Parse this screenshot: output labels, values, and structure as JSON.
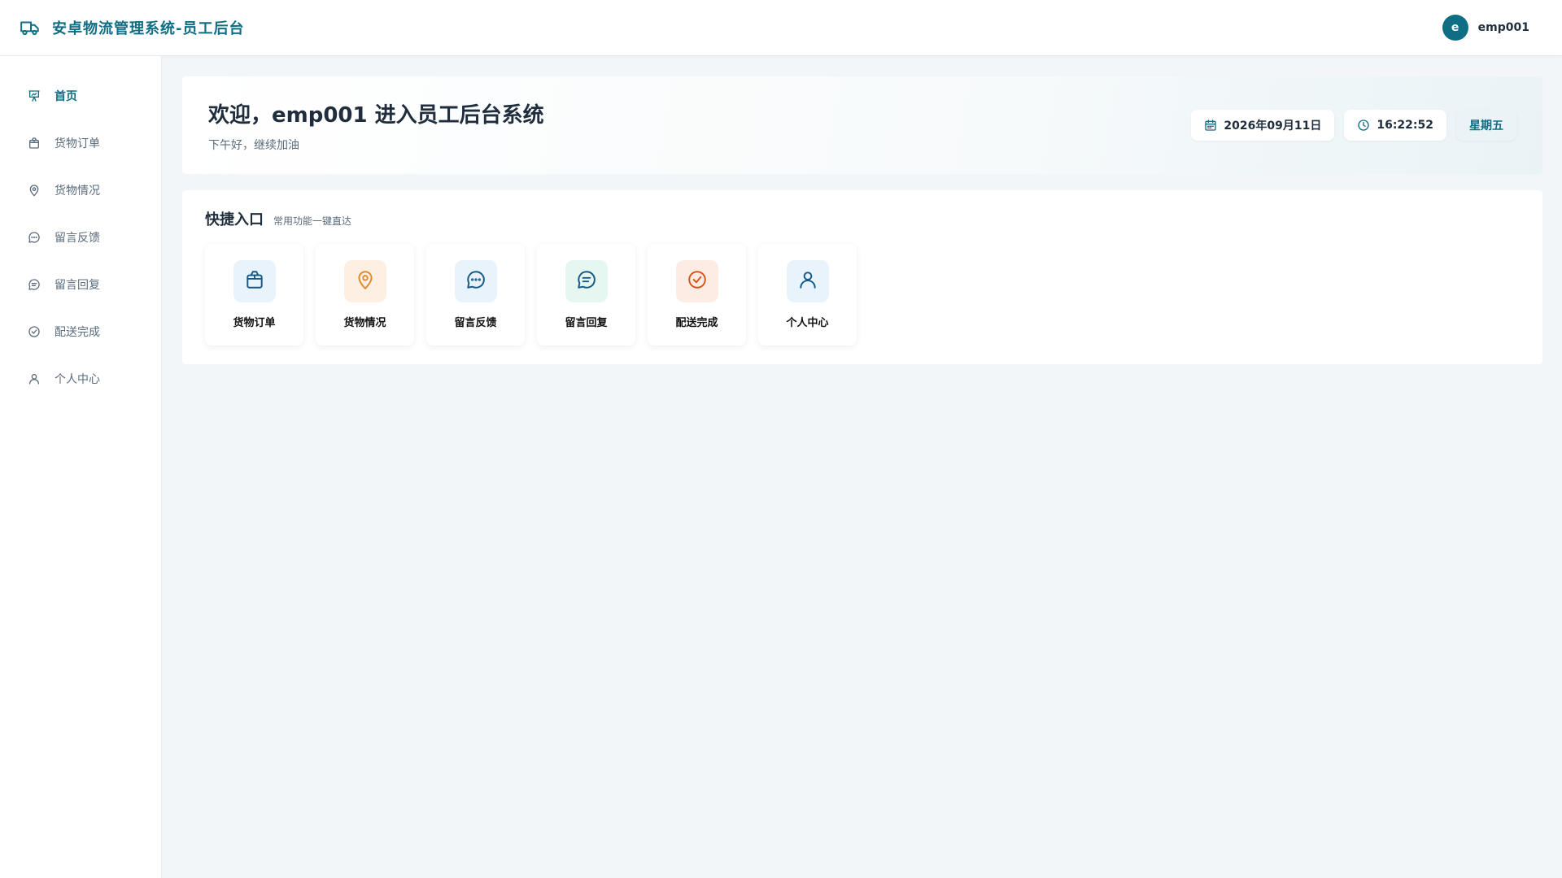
{
  "header": {
    "title": "安卓物流管理系统-员工后台",
    "brand_icon": "truck-icon",
    "avatar_letter": "e",
    "username": "emp001"
  },
  "sidebar": {
    "items": [
      {
        "label": "首页",
        "icon": "dashboard-icon",
        "active": true
      },
      {
        "label": "货物订单",
        "icon": "package-icon"
      },
      {
        "label": "货物情况",
        "icon": "location-pin-icon"
      },
      {
        "label": "留言反馈",
        "icon": "chat-dots-icon"
      },
      {
        "label": "留言回复",
        "icon": "chat-lines-icon"
      },
      {
        "label": "配送完成",
        "icon": "check-circle-icon"
      },
      {
        "label": "个人中心",
        "icon": "user-icon"
      }
    ]
  },
  "welcome": {
    "title": "欢迎，emp001 进入员工后台系统",
    "subtitle": "下午好，继续加油",
    "date": "2026年09月11日",
    "time": "16:22:52",
    "weekday": "星期五"
  },
  "quick": {
    "title": "快捷入口",
    "subtitle": "常用功能一键直达",
    "cards": [
      {
        "label": "货物订单",
        "icon": "package-icon",
        "bg": "#e8f3fb",
        "color": "#155a86"
      },
      {
        "label": "货物情况",
        "icon": "location-pin-icon",
        "bg": "#fdf0e3",
        "color": "#e08a2c"
      },
      {
        "label": "留言反馈",
        "icon": "chat-dots-icon",
        "bg": "#e8f3fb",
        "color": "#155a86"
      },
      {
        "label": "留言回复",
        "icon": "chat-lines-icon",
        "bg": "#e6f6f1",
        "color": "#155a86"
      },
      {
        "label": "配送完成",
        "icon": "check-circle-icon",
        "bg": "#fdece3",
        "color": "#d4561a"
      },
      {
        "label": "个人中心",
        "icon": "user-icon",
        "bg": "#e8f3fb",
        "color": "#155a86"
      }
    ]
  },
  "colors": {
    "brand": "#0f6e84",
    "background": "#f3f6f9"
  }
}
